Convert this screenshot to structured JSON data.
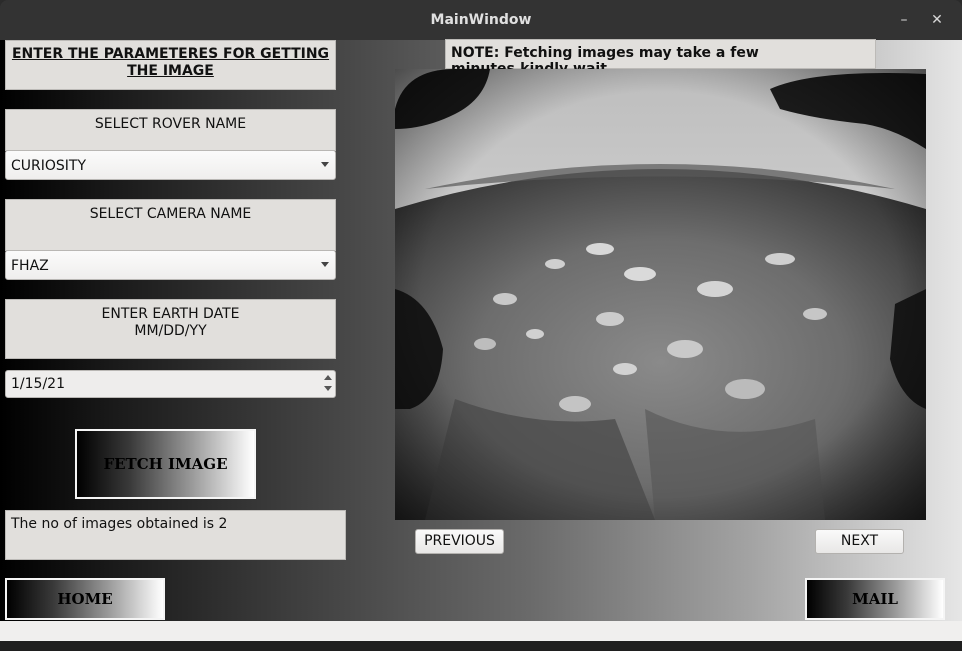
{
  "window": {
    "title": "MainWindow",
    "minimize": "–",
    "close": "✕"
  },
  "left": {
    "header": "ENTER THE PARAMETERES FOR GETTING THE IMAGE",
    "rover_label": "SELECT ROVER NAME",
    "rover_value": "CURIOSITY",
    "camera_label": "SELECT CAMERA NAME",
    "camera_value": "FHAZ",
    "date_label_line1": "ENTER EARTH DATE",
    "date_label_line2": "MM/DD/YY",
    "date_value": "1/15/21",
    "fetch_button": "FETCH IMAGE",
    "result_text": "The no of images obtained is 2"
  },
  "right": {
    "note": "NOTE: Fetching images may take a few minutes,kindly wait",
    "prev_button": "PREVIOUS",
    "next_button": "NEXT"
  },
  "bottom": {
    "home_button": "HOME",
    "mail_button": "MAIL"
  }
}
